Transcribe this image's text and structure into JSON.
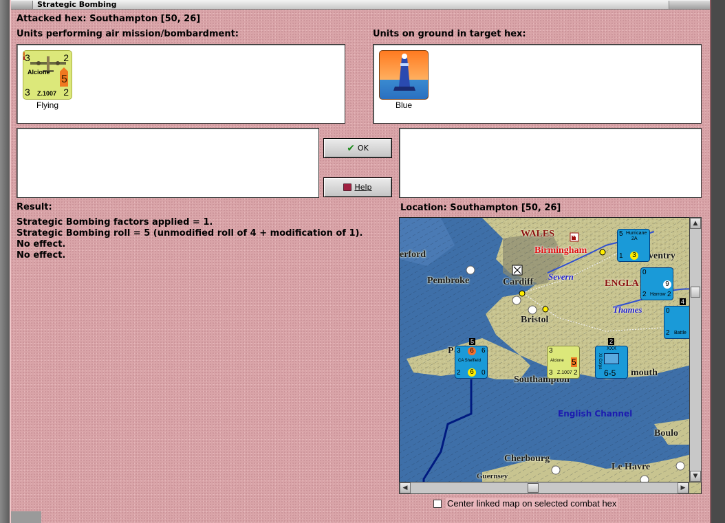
{
  "window": {
    "title": "Strategic Bombing"
  },
  "header": {
    "attacked_hex": "Attacked hex: Southampton  [50, 26]"
  },
  "attackers": {
    "label": "Units performing air mission/bombardment:",
    "units": [
      {
        "name": "Alcione",
        "model": "Z.1007",
        "top_left": "3",
        "top_right": "2",
        "bottom_left": "3",
        "bottom_right": "2",
        "center_value": "5",
        "caption": "Flying",
        "color": "#dce87a"
      }
    ]
  },
  "defenders": {
    "label": "Units on ground in target hex:",
    "units": [
      {
        "caption": "Blue",
        "icon": "lighthouse-icon",
        "color": "#ff8c1a"
      }
    ]
  },
  "buttons": {
    "ok": "OK",
    "help": "Help"
  },
  "result": {
    "label": "Result:",
    "lines": [
      "Strategic Bombing factors applied = 1.",
      "Strategic Bombing roll = 5 (unmodified roll of 4 + modification of 1).",
      "No effect.",
      "No effect."
    ]
  },
  "location": {
    "label": "Location:  Southampton  [50, 26]",
    "map_labels": {
      "wales": "WALES",
      "birmingham": "Birmingham",
      "coventry": "ventry",
      "haverford": "erford",
      "pembroke": "Pembroke",
      "cardiff": "Cardiff",
      "severn": "Severn",
      "england": "ENGLA",
      "thames": "Thames",
      "bristol": "Bristol",
      "plymouth": "P      th",
      "southampton": "Southampton",
      "portsmouth": "mouth",
      "english_channel": "English Channel",
      "boulogne": "Boulo",
      "cherbourg": "Cherbourg",
      "le_havre": "Le Havre",
      "guernsey": "Guernsey"
    },
    "map_counters": {
      "hurricane": {
        "name": "Hurricane",
        "sub": "2A",
        "tl": "5",
        "bl": "1",
        "bc": "3"
      },
      "harrow": {
        "name": "Harrow",
        "tl": "0",
        "bl": "2",
        "br": "2",
        "mid": "9"
      },
      "battle": {
        "name": "Battle",
        "tl": "0",
        "bl": "2",
        "top_tag": "4"
      },
      "sheffield": {
        "name": "CA Sheffield",
        "tl": "3",
        "tc": "6",
        "tr": "6",
        "bl": "2",
        "bc": "6",
        "br": "0",
        "top_tag": "5"
      },
      "alcione": {
        "name": "Alcione",
        "model": "Z.1007",
        "tl": "3",
        "bl": "3",
        "br": "2",
        "mid": "5"
      },
      "corps": {
        "strength": "6-5",
        "size": "XXX",
        "top_tag": "2",
        "name": "XI Corps"
      }
    }
  },
  "center_option": {
    "label": "Center linked map on selected combat hex",
    "checked": false
  }
}
